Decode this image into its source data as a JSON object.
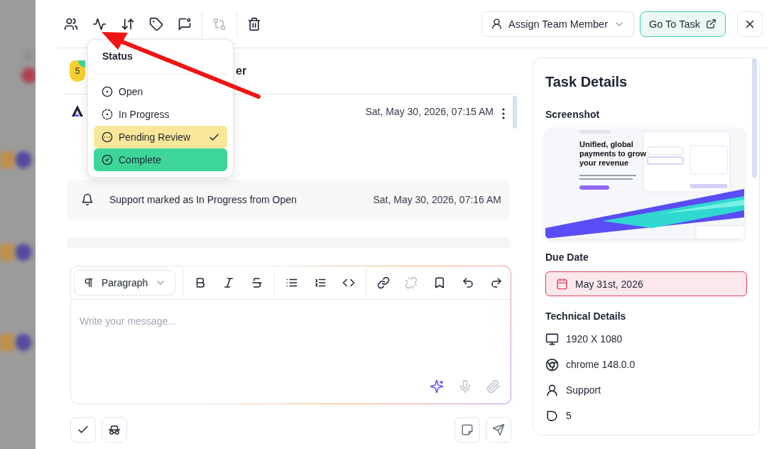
{
  "toolbar": [
    {
      "kind": "assignees",
      "disabled": false
    },
    {
      "kind": "status",
      "disabled": false
    },
    {
      "kind": "sort",
      "disabled": false
    },
    {
      "kind": "tag",
      "disabled": false
    },
    {
      "kind": "comment",
      "disabled": false
    },
    {
      "kind": "compare",
      "disabled": true
    },
    {
      "kind": "delete",
      "disabled": false
    }
  ],
  "assign_button": {
    "label": "Assign Team Member"
  },
  "go_to_task": {
    "label": "Go To Task"
  },
  "status_menu": {
    "title": "Status",
    "items": [
      {
        "kind": "open",
        "label": "Open",
        "selected": false,
        "color": "#ffffff"
      },
      {
        "kind": "in_progress",
        "label": "In Progress",
        "selected": false,
        "color": "#ffffff"
      },
      {
        "kind": "pending_review",
        "label": "Pending Review",
        "selected": true,
        "color": "#fbe79a"
      },
      {
        "kind": "complete",
        "label": "Complete",
        "selected": false,
        "color": "#3dd598"
      }
    ]
  },
  "task": {
    "badge": "5",
    "title_fragment": "er"
  },
  "messages": [
    {
      "date": "Sat, May 30, 2026, 07:15 AM"
    }
  ],
  "activity": [
    {
      "text": "Support marked as In Progress from Open",
      "date": "Sat, May 30, 2026, 07:16 AM"
    }
  ],
  "editor": {
    "block_format": "Paragraph",
    "placeholder": "Write your message...",
    "tools": [
      {
        "kind": "bold",
        "disabled": false
      },
      {
        "kind": "italic",
        "disabled": false
      },
      {
        "kind": "strike",
        "disabled": false
      },
      {
        "kind": "bullets",
        "disabled": false
      },
      {
        "kind": "numbers",
        "disabled": false
      },
      {
        "kind": "code",
        "disabled": false
      },
      {
        "kind": "link",
        "disabled": false
      },
      {
        "kind": "unlink",
        "disabled": true
      },
      {
        "kind": "bookmark",
        "disabled": false
      },
      {
        "kind": "undo",
        "disabled": false
      },
      {
        "kind": "redo",
        "disabled": false
      }
    ],
    "inline_tools": [
      {
        "kind": "ai",
        "disabled": false
      },
      {
        "kind": "mic",
        "disabled": true
      },
      {
        "kind": "attach",
        "disabled": true
      }
    ]
  },
  "actions": [
    {
      "kind": "resolve"
    },
    {
      "kind": "private"
    }
  ],
  "send_actions": [
    {
      "kind": "note"
    },
    {
      "kind": "send"
    }
  ],
  "details": {
    "title": "Task Details",
    "screenshot_label": "Screenshot",
    "screenshot": {
      "headline": "Unified, global payments to grow your revenue"
    },
    "due_label": "Due Date",
    "due_date": "May 31st, 2026",
    "overdue": true,
    "tech_label": "Technical Details",
    "tech": [
      {
        "kind": "screen",
        "text": "1920 X 1080"
      },
      {
        "kind": "browser",
        "text": "chrome 148.0.0"
      },
      {
        "kind": "user",
        "text": "Support"
      },
      {
        "kind": "points",
        "text": "5"
      }
    ]
  }
}
